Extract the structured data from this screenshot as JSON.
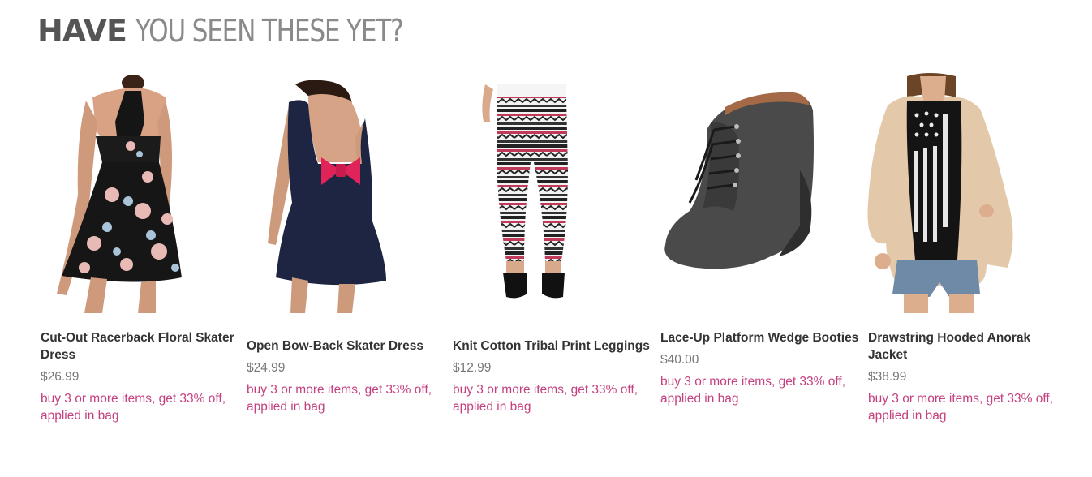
{
  "section": {
    "title_bold": "HAVE",
    "title_light": "YOU SEEN THESE YET?"
  },
  "products": [
    {
      "name": "Cut-Out Racerback Floral Skater Dress",
      "price": "$26.99",
      "promo": "buy 3 or more items, get 33% off, applied in bag"
    },
    {
      "name": "Open Bow-Back Skater Dress",
      "price": "$24.99",
      "promo": "buy 3 or more items, get 33% off, applied in bag"
    },
    {
      "name": "Knit Cotton Tribal Print Leggings",
      "price": "$12.99",
      "promo": "buy 3 or more items, get 33% off, applied in bag"
    },
    {
      "name": "Lace-Up Platform Wedge Booties",
      "price": "$40.00",
      "promo": "buy 3 or more items, get 33% off, applied in bag"
    },
    {
      "name": "Drawstring Hooded Anorak Jacket",
      "price": "$38.99",
      "promo": "buy 3 or more items, get 33% off, applied in bag"
    }
  ],
  "colors": {
    "title": "#555555",
    "name": "#333333",
    "price": "#777777",
    "promo": "#c4417f"
  }
}
